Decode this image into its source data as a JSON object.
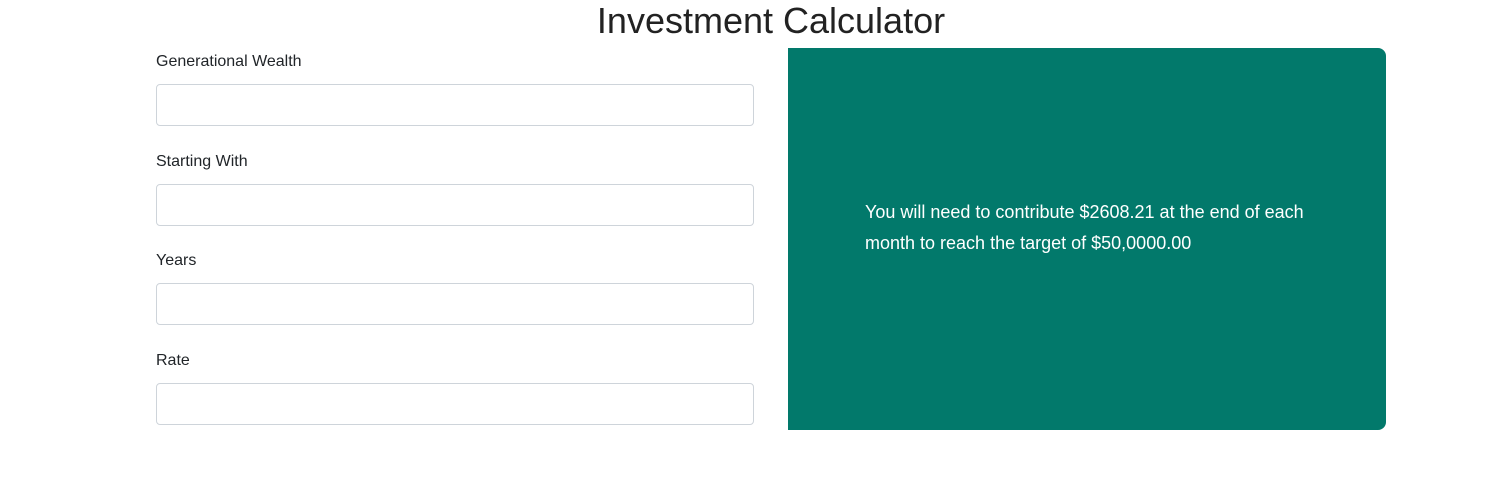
{
  "page": {
    "title": "Investment Calculator"
  },
  "form": {
    "fields": [
      {
        "label": "Generational Wealth",
        "value": "",
        "placeholder": ""
      },
      {
        "label": "Starting With",
        "value": "",
        "placeholder": ""
      },
      {
        "label": "Years",
        "value": "",
        "placeholder": ""
      },
      {
        "label": "Rate",
        "value": "",
        "placeholder": ""
      }
    ]
  },
  "result": {
    "message": "You will need to contribute $2608.21 at the end of each month to reach the target of $50,0000.00",
    "background_color": "#02796b",
    "text_color": "#ffffff"
  }
}
